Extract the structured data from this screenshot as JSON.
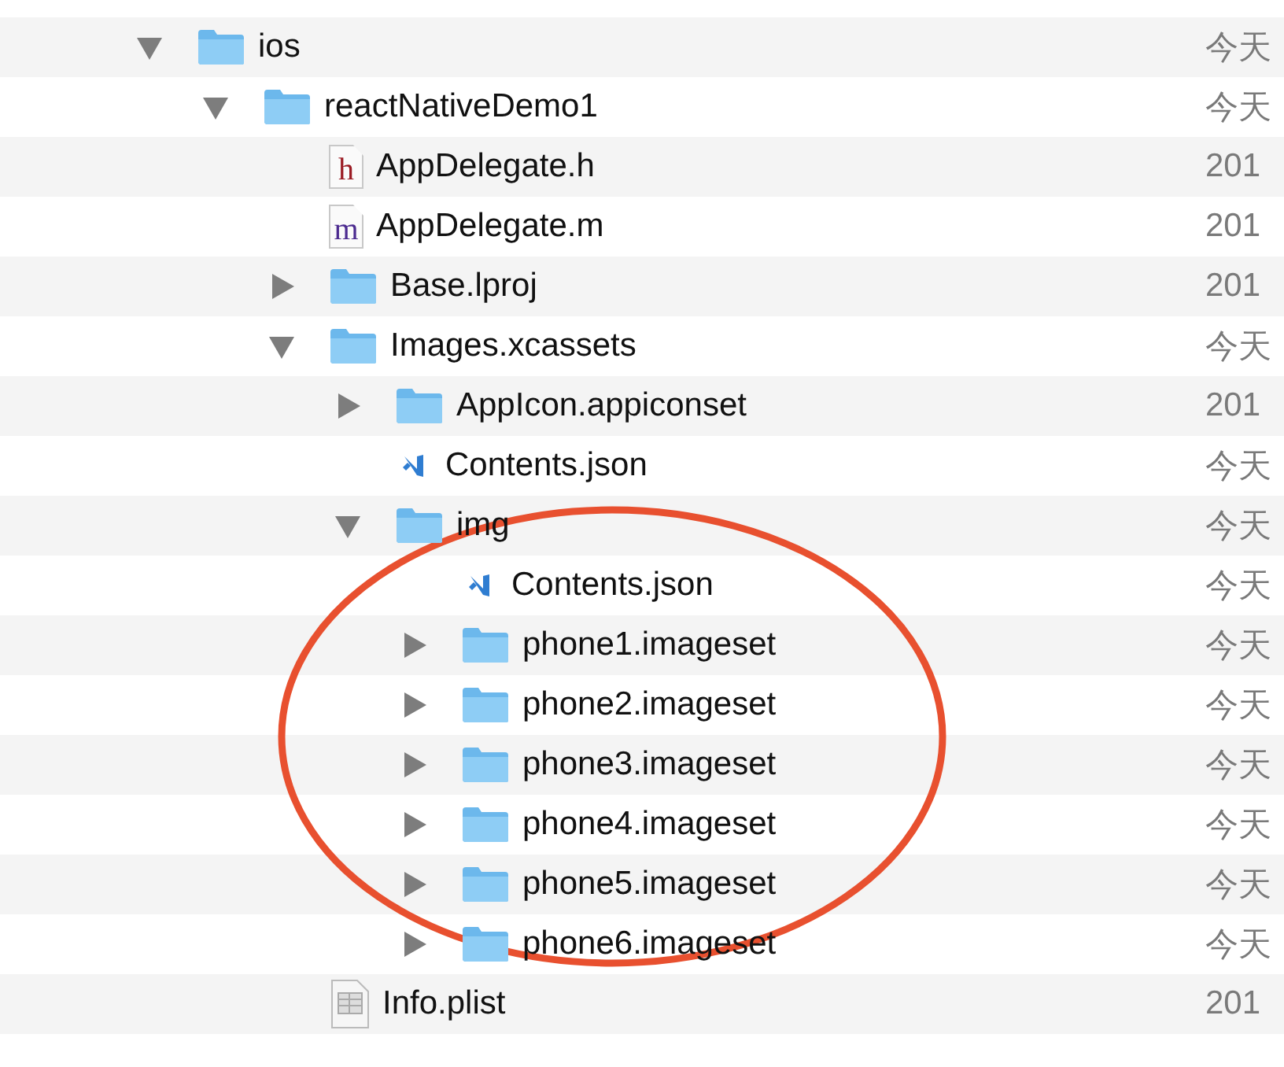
{
  "files": [
    {
      "name": "ios",
      "kind": "folder",
      "expanded": true,
      "date": "今天",
      "children": [
        {
          "name": "reactNativeDemo1",
          "kind": "folder",
          "expanded": true,
          "date": "今天",
          "children": [
            {
              "name": "AppDelegate.h",
              "kind": "letter",
              "glyph": "h",
              "date": "201"
            },
            {
              "name": "AppDelegate.m",
              "kind": "letter",
              "glyph": "m",
              "date": "201"
            },
            {
              "name": "Base.lproj",
              "kind": "folder",
              "expanded": false,
              "date": "201"
            },
            {
              "name": "Images.xcassets",
              "kind": "folder",
              "expanded": true,
              "date": "今天",
              "children": [
                {
                  "name": "AppIcon.appiconset",
                  "kind": "folder",
                  "expanded": false,
                  "date": "201"
                },
                {
                  "name": "Contents.json",
                  "kind": "json",
                  "date": "今天"
                },
                {
                  "name": "img",
                  "kind": "folder",
                  "expanded": true,
                  "date": "今天",
                  "children": [
                    {
                      "name": "Contents.json",
                      "kind": "json",
                      "date": "今天"
                    },
                    {
                      "name": "phone1.imageset",
                      "kind": "folder",
                      "expanded": false,
                      "date": "今天"
                    },
                    {
                      "name": "phone2.imageset",
                      "kind": "folder",
                      "expanded": false,
                      "date": "今天"
                    },
                    {
                      "name": "phone3.imageset",
                      "kind": "folder",
                      "expanded": false,
                      "date": "今天"
                    },
                    {
                      "name": "phone4.imageset",
                      "kind": "folder",
                      "expanded": false,
                      "date": "今天"
                    },
                    {
                      "name": "phone5.imageset",
                      "kind": "folder",
                      "expanded": false,
                      "date": "今天"
                    },
                    {
                      "name": "phone6.imageset",
                      "kind": "folder",
                      "expanded": false,
                      "date": "今天"
                    }
                  ]
                }
              ]
            },
            {
              "name": "Info.plist",
              "kind": "plist",
              "date": "201"
            }
          ]
        }
      ]
    }
  ],
  "highlight_circle": true
}
